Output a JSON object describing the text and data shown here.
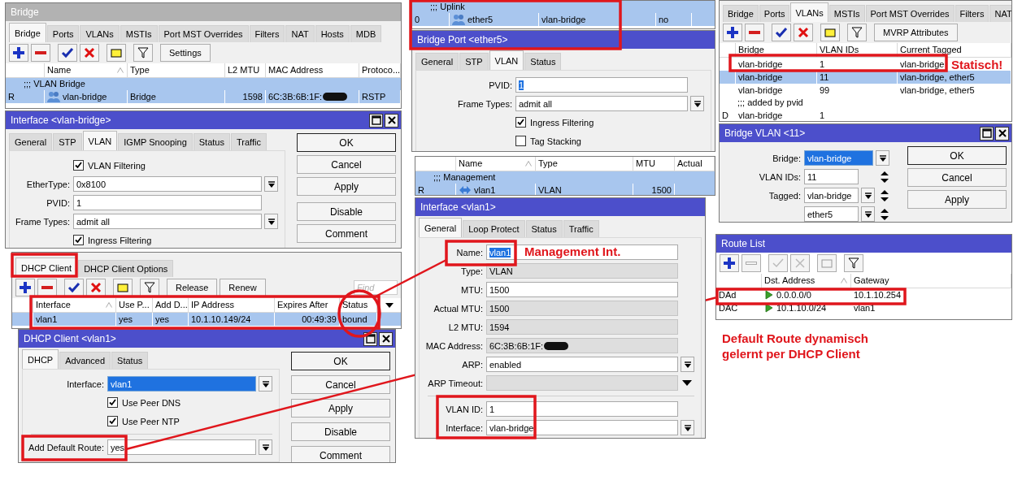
{
  "bridge_window": {
    "title": {
      "text": "Bridge",
      "active": false
    },
    "tabs": [
      {
        "label": "Bridge",
        "selected": true
      },
      {
        "label": "Ports",
        "selected": false
      },
      {
        "label": "VLANs",
        "selected": false
      },
      {
        "label": "MSTIs",
        "selected": false
      },
      {
        "label": "Port MST Overrides",
        "selected": false
      },
      {
        "label": "Filters",
        "selected": false
      },
      {
        "label": "NAT",
        "selected": false
      },
      {
        "label": "Hosts",
        "selected": false
      },
      {
        "label": "MDB",
        "selected": false
      }
    ],
    "toolbar": {
      "tools": [
        {
          "kind": "add",
          "disabled": false
        },
        {
          "kind": "remove",
          "disabled": false
        },
        {
          "kind": "enable",
          "disabled": false
        },
        {
          "kind": "disable",
          "disabled": false
        },
        {
          "kind": "comment",
          "disabled": false
        },
        {
          "kind": "filter",
          "disabled": false
        }
      ],
      "buttons": [
        "Settings"
      ]
    },
    "table": {
      "columns": [
        {
          "label": "Name",
          "sorted": true
        },
        {
          "label": "Type",
          "sorted": false
        },
        {
          "label": "L2 MTU",
          "sorted": false
        },
        {
          "label": "MAC Address",
          "sorted": false
        },
        {
          "label": "Protoco...",
          "sorted": false
        }
      ],
      "rows": [
        {
          "kind": "comment",
          "text": ";;; VLAN Bridge",
          "selected": true
        },
        {
          "kind": "bridge",
          "flag": "R",
          "cells": [
            "vlan-bridge",
            "Bridge",
            "1598",
            {
              "text": "6C:3B:6B:1F:",
              "redacted": true
            },
            "RSTP"
          ],
          "selected": true
        }
      ]
    }
  },
  "interface_vlan_bridge": {
    "title": {
      "text": "Interface <vlan-bridge>",
      "active": true
    },
    "window_buttons": true,
    "tabs": [
      {
        "label": "General",
        "selected": false
      },
      {
        "label": "STP",
        "selected": false
      },
      {
        "label": "VLAN",
        "selected": true
      },
      {
        "label": "IGMP Snooping",
        "selected": false
      },
      {
        "label": "Status",
        "selected": false
      },
      {
        "label": "Traffic",
        "selected": false
      }
    ],
    "fields": [
      {
        "kind": "checkbox",
        "label": "VLAN Filtering",
        "checked": true
      },
      {
        "kind": "dropdown",
        "label": "EtherType:",
        "value": "0x8100",
        "highlighted": false
      },
      {
        "kind": "text",
        "label": "PVID:",
        "value": "1",
        "highlighted": false
      },
      {
        "kind": "dropdown",
        "label": "Frame Types:",
        "value": "admit all",
        "highlighted": false
      },
      {
        "kind": "checkbox",
        "label": "Ingress Filtering",
        "checked": true
      }
    ],
    "buttons": [
      [
        "OK",
        "Cancel",
        "Apply"
      ],
      [
        "Disable",
        "Comment"
      ]
    ]
  },
  "dhcp_client_list": {
    "tabs": [
      {
        "label": "DHCP Client",
        "selected": true
      },
      {
        "label": "DHCP Client Options",
        "selected": false
      }
    ],
    "toolbar": {
      "tools": [
        {
          "kind": "add",
          "disabled": false
        },
        {
          "kind": "remove",
          "disabled": false
        },
        {
          "kind": "enable",
          "disabled": false
        },
        {
          "kind": "disable",
          "disabled": false
        },
        {
          "kind": "comment",
          "disabled": false
        },
        {
          "kind": "filter",
          "disabled": false
        }
      ],
      "buttons": [
        "Release",
        "Renew"
      ],
      "search": {
        "placeholder": "Find"
      }
    },
    "table": {
      "columns": [
        {
          "label": "Interface",
          "sorted": true
        },
        {
          "label": "Use P...",
          "sorted": false
        },
        {
          "label": "Add D...",
          "sorted": false
        },
        {
          "label": "IP Address",
          "sorted": false
        },
        {
          "label": "Expires After",
          "sorted": false
        },
        {
          "label": "Status",
          "sorted": false
        }
      ],
      "rows": [
        {
          "cells": [
            "vlan1",
            "yes",
            "yes",
            "10.1.10.149/24",
            "00:49:39",
            "bound"
          ],
          "selected": true
        }
      ]
    }
  },
  "dhcp_client_dialog": {
    "title": {
      "text": "DHCP Client <vlan1>",
      "active": true
    },
    "window_buttons": true,
    "tabs": [
      {
        "label": "DHCP",
        "selected": true
      },
      {
        "label": "Advanced",
        "selected": false
      },
      {
        "label": "Status",
        "selected": false
      }
    ],
    "fields": [
      {
        "kind": "dropdown",
        "label": "Interface:",
        "value": "vlan1",
        "highlighted": true
      },
      {
        "kind": "checkbox",
        "label": "Use Peer DNS",
        "checked": true
      },
      {
        "kind": "checkbox",
        "label": "Use Peer NTP",
        "checked": true
      },
      {
        "kind": "separator"
      },
      {
        "kind": "dropdown",
        "label": "Add Default Route:",
        "value": "yes",
        "highlighted": false
      }
    ],
    "buttons": [
      [
        "OK",
        "Cancel",
        "Apply"
      ],
      [
        "Disable",
        "Comment"
      ]
    ]
  },
  "bridge_port_list": {
    "table": {
      "rows": [
        {
          "kind": "comment",
          "text": ";;; Uplink",
          "selected": true
        },
        {
          "kind": "port",
          "flag": "0",
          "cells": [
            "ether5",
            "vlan-bridge",
            "no"
          ],
          "selected": true
        }
      ]
    }
  },
  "bridge_port_dialog": {
    "title": {
      "text": "Bridge Port <ether5>",
      "active": true
    },
    "tabs": [
      {
        "label": "General",
        "selected": false
      },
      {
        "label": "STP",
        "selected": false
      },
      {
        "label": "VLAN",
        "selected": true
      },
      {
        "label": "Status",
        "selected": false
      }
    ],
    "fields": [
      {
        "kind": "text",
        "label": "PVID:",
        "value": "1",
        "highlighted": true
      },
      {
        "kind": "dropdown",
        "label": "Frame Types:",
        "value": "admit all",
        "highlighted": false
      },
      {
        "kind": "checkbox",
        "label": "Ingress Filtering",
        "checked": true
      },
      {
        "kind": "checkbox",
        "label": "Tag Stacking",
        "checked": false
      },
      {
        "kind": "separator"
      }
    ]
  },
  "interface_list": {
    "table": {
      "columns": [
        {
          "label": "Name",
          "sorted": true
        },
        {
          "label": "Type",
          "sorted": false
        },
        {
          "label": "MTU",
          "sorted": false
        },
        {
          "label": "Actual",
          "sorted": false
        }
      ],
      "rows": [
        {
          "kind": "comment",
          "text": ";;; Management",
          "selected": true
        },
        {
          "kind": "vlan",
          "flag": "R",
          "cells": [
            "vlan1",
            "VLAN",
            "1500"
          ],
          "selected": true
        }
      ]
    }
  },
  "interface_vlan1": {
    "title": {
      "text": "Interface <vlan1>",
      "active": true
    },
    "tabs": [
      {
        "label": "General",
        "selected": true
      },
      {
        "label": "Loop Protect",
        "selected": false
      },
      {
        "label": "Status",
        "selected": false
      },
      {
        "label": "Traffic",
        "selected": false
      }
    ],
    "fields": [
      {
        "kind": "text",
        "label": "Name:",
        "value": "vlan1",
        "highlighted": true,
        "readonly": false
      },
      {
        "kind": "text",
        "label": "Type:",
        "value": "VLAN",
        "highlighted": false,
        "readonly": true
      },
      {
        "kind": "text",
        "label": "MTU:",
        "value": "1500",
        "highlighted": false,
        "readonly": false
      },
      {
        "kind": "text",
        "label": "Actual MTU:",
        "value": "1500",
        "highlighted": false,
        "readonly": true
      },
      {
        "kind": "text",
        "label": "L2 MTU:",
        "value": "1594",
        "highlighted": false,
        "readonly": true
      },
      {
        "kind": "text",
        "label": "MAC Address:",
        "value": "6C:3B:6B:1F:",
        "redacted": true,
        "highlighted": false,
        "readonly": true
      },
      {
        "kind": "dropdown",
        "label": "ARP:",
        "value": "enabled",
        "highlighted": false,
        "readonly": false
      },
      {
        "kind": "combo",
        "label": "ARP Timeout:",
        "highlighted": false,
        "readonly": true
      },
      {
        "kind": "separator"
      },
      {
        "kind": "text",
        "label": "VLAN ID:",
        "value": "1",
        "highlighted": false,
        "readonly": false
      },
      {
        "kind": "dropdown",
        "label": "Interface:",
        "value": "vlan-bridge",
        "highlighted": false,
        "readonly": false
      }
    ]
  },
  "bridge_vlans": {
    "tabs": [
      {
        "label": "Bridge",
        "selected": false
      },
      {
        "label": "Ports",
        "selected": false
      },
      {
        "label": "VLANs",
        "selected": true
      },
      {
        "label": "MSTIs",
        "selected": false
      },
      {
        "label": "Port MST Overrides",
        "selected": false
      },
      {
        "label": "Filters",
        "selected": false
      },
      {
        "label": "NAT",
        "selected": false
      }
    ],
    "toolbar": {
      "tools": [
        {
          "kind": "add",
          "disabled": false
        },
        {
          "kind": "remove",
          "disabled": false
        },
        {
          "kind": "enable",
          "disabled": false
        },
        {
          "kind": "disable",
          "disabled": false
        },
        {
          "kind": "comment",
          "disabled": false
        },
        {
          "kind": "filter",
          "disabled": false
        }
      ],
      "buttons": [
        "MVRP Attributes"
      ]
    },
    "table": {
      "columns": [
        {
          "label": "Bridge",
          "sorted": false
        },
        {
          "label": "VLAN IDs",
          "sorted": false
        },
        {
          "label": "Current Tagged",
          "sorted": false
        }
      ],
      "rows": [
        {
          "kind": "vlan-entry",
          "cells": [
            "vlan-bridge",
            "1",
            "vlan-bridge"
          ],
          "selected": false
        },
        {
          "kind": "vlan-entry",
          "cells": [
            "vlan-bridge",
            "11",
            "vlan-bridge, ether5"
          ],
          "selected": true
        },
        {
          "kind": "vlan-entry",
          "cells": [
            "vlan-bridge",
            "99",
            "vlan-bridge, ether5"
          ],
          "selected": false
        },
        {
          "kind": "comment",
          "text": ";;; added by pvid",
          "selected": false
        },
        {
          "kind": "vlan-entry",
          "flag": "D",
          "cells": [
            "vlan-bridge",
            "1"
          ],
          "selected": false
        }
      ]
    }
  },
  "bridge_vlan_dialog": {
    "title": {
      "text": "Bridge VLAN <11>",
      "active": true
    },
    "window_buttons": true,
    "fields": [
      {
        "kind": "dropdown",
        "label": "Bridge:",
        "value": "vlan-bridge",
        "highlighted": true
      },
      {
        "kind": "spinner",
        "label": "VLAN IDs:",
        "value": "11",
        "highlighted": false
      },
      {
        "kind": "dropdown-spinner",
        "label": "Tagged:",
        "value": "vlan-bridge",
        "highlighted": false
      },
      {
        "kind": "dropdown-spinner",
        "value": "ether5",
        "highlighted": false
      }
    ],
    "buttons": [
      [
        "OK",
        "Cancel",
        "Apply"
      ]
    ]
  },
  "route_list": {
    "title": {
      "text": "Route List",
      "active": true
    },
    "toolbar": {
      "tools": [
        {
          "kind": "add",
          "disabled": false
        },
        {
          "kind": "remove",
          "disabled": true
        },
        {
          "kind": "enable",
          "disabled": true
        },
        {
          "kind": "disable",
          "disabled": true
        },
        {
          "kind": "comment",
          "disabled": true
        },
        {
          "kind": "filter",
          "disabled": false
        }
      ]
    },
    "table": {
      "columns": [
        {
          "label": "Dst. Address",
          "sorted": true
        },
        {
          "label": "Gateway",
          "sorted": false
        }
      ],
      "rows": [
        {
          "kind": "route",
          "flag": "DAd",
          "cells": [
            "0.0.0.0/0",
            "10.1.10.254"
          ],
          "selected": false
        },
        {
          "kind": "route",
          "flag": "DAC",
          "cells": [
            "10.1.10.0/24",
            "vlan1"
          ],
          "selected": false
        }
      ]
    }
  },
  "annotations": {
    "statisch": "Statisch!",
    "management_int": "Management Int.",
    "default_route_note": "Default Route dynamisch gelernt per DHCP Client"
  }
}
